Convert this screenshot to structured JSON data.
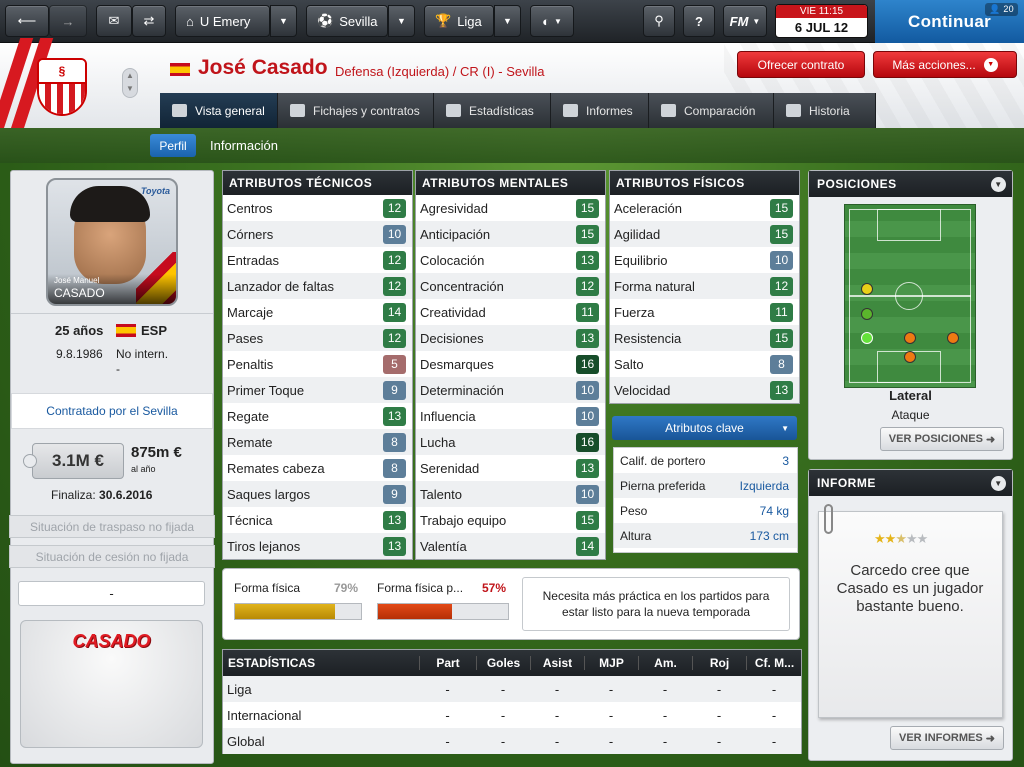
{
  "topbar": {
    "manager": "U Emery",
    "club": "Sevilla",
    "competition": "Liga",
    "fm_label": "FM",
    "date_line1": "VIE 11:15",
    "date_line2": "6 JUL 12",
    "continue_label": "Continuar",
    "continue_badge": "20"
  },
  "player": {
    "name": "José Casado",
    "position": "Defensa (Izquierda) / CR (I) - Sevilla",
    "age": "25 años",
    "nationality": "ESP",
    "dob": "9.8.1986",
    "intl": "No intern.",
    "intl_dash": "-",
    "contract_label": "Contratado por el Sevilla",
    "value": "3.1M €",
    "wage": "875m €",
    "wage_period": "al año",
    "expires_label": "Finaliza:",
    "expires": "30.6.2016",
    "transfer_status": "Situación de traspaso no fijada",
    "loan_status": "Situación de cesión no fijada",
    "dash_box": "-",
    "photo_firstname": "José Manuel",
    "photo_surname": "CASADO",
    "photo_logo": "Toyota",
    "shirt_name": "CASADO"
  },
  "header_buttons": {
    "offer": "Ofrecer contrato",
    "more": "Más acciones..."
  },
  "tabs": [
    "Vista general",
    "Fichajes y contratos",
    "Estadísticas",
    "Informes",
    "Comparación",
    "Historia"
  ],
  "subnav": {
    "profile": "Perfil",
    "info": "Información"
  },
  "technical": {
    "title": "ATRIBUTOS TÉCNICOS",
    "rows": [
      {
        "name": "Centros",
        "value": "12",
        "color": "#2f7c46"
      },
      {
        "name": "Córners",
        "value": "10",
        "color": "#5d7e99"
      },
      {
        "name": "Entradas",
        "value": "12",
        "color": "#2f7c46"
      },
      {
        "name": "Lanzador de faltas",
        "value": "12",
        "color": "#2f7c46"
      },
      {
        "name": "Marcaje",
        "value": "14",
        "color": "#2f7c46"
      },
      {
        "name": "Pases",
        "value": "12",
        "color": "#2f7c46"
      },
      {
        "name": "Penaltis",
        "value": "5",
        "color": "#a56c6c"
      },
      {
        "name": "Primer Toque",
        "value": "9",
        "color": "#5d7e99"
      },
      {
        "name": "Regate",
        "value": "13",
        "color": "#2f7c46"
      },
      {
        "name": "Remate",
        "value": "8",
        "color": "#5d7e99"
      },
      {
        "name": "Remates cabeza",
        "value": "8",
        "color": "#5d7e99"
      },
      {
        "name": "Saques largos",
        "value": "9",
        "color": "#5d7e99"
      },
      {
        "name": "Técnica",
        "value": "13",
        "color": "#2f7c46"
      },
      {
        "name": "Tiros lejanos",
        "value": "13",
        "color": "#2f7c46"
      }
    ]
  },
  "mental": {
    "title": "ATRIBUTOS MENTALES",
    "rows": [
      {
        "name": "Agresividad",
        "value": "15",
        "color": "#2f7c46"
      },
      {
        "name": "Anticipación",
        "value": "15",
        "color": "#2f7c46"
      },
      {
        "name": "Colocación",
        "value": "13",
        "color": "#2f7c46"
      },
      {
        "name": "Concentración",
        "value": "12",
        "color": "#2f7c46"
      },
      {
        "name": "Creatividad",
        "value": "11",
        "color": "#2f7c46"
      },
      {
        "name": "Decisiones",
        "value": "13",
        "color": "#2f7c46"
      },
      {
        "name": "Desmarques",
        "value": "16",
        "color": "#174d2a"
      },
      {
        "name": "Determinación",
        "value": "10",
        "color": "#5d7e99"
      },
      {
        "name": "Influencia",
        "value": "10",
        "color": "#5d7e99"
      },
      {
        "name": "Lucha",
        "value": "16",
        "color": "#174d2a"
      },
      {
        "name": "Serenidad",
        "value": "13",
        "color": "#2f7c46"
      },
      {
        "name": "Talento",
        "value": "10",
        "color": "#5d7e99"
      },
      {
        "name": "Trabajo equipo",
        "value": "15",
        "color": "#2f7c46"
      },
      {
        "name": "Valentía",
        "value": "14",
        "color": "#2f7c46"
      }
    ]
  },
  "physical": {
    "title": "ATRIBUTOS FÍSICOS",
    "rows": [
      {
        "name": "Aceleración",
        "value": "15",
        "color": "#2f7c46"
      },
      {
        "name": "Agilidad",
        "value": "15",
        "color": "#2f7c46"
      },
      {
        "name": "Equilibrio",
        "value": "10",
        "color": "#5d7e99"
      },
      {
        "name": "Forma natural",
        "value": "12",
        "color": "#2f7c46"
      },
      {
        "name": "Fuerza",
        "value": "11",
        "color": "#2f7c46"
      },
      {
        "name": "Resistencia",
        "value": "15",
        "color": "#2f7c46"
      },
      {
        "name": "Salto",
        "value": "8",
        "color": "#5d7e99"
      },
      {
        "name": "Velocidad",
        "value": "13",
        "color": "#2f7c46"
      }
    ]
  },
  "key_attributes": {
    "title": "Atributos clave",
    "rows": [
      {
        "name": "Calif. de portero",
        "value": "3"
      },
      {
        "name": "Pierna preferida",
        "value": "Izquierda"
      },
      {
        "name": "Peso",
        "value": "74 kg"
      },
      {
        "name": "Altura",
        "value": "173 cm"
      }
    ]
  },
  "fitness": {
    "physical_label": "Forma física",
    "physical_pct": "79%",
    "physical_level": 0.79,
    "match_label": "Forma física p...",
    "match_pct": "57%",
    "match_level": 0.57,
    "note": "Necesita más práctica en los partidos para estar listo para la nueva temporada"
  },
  "stats": {
    "title": "ESTADÍSTICAS",
    "columns": [
      "Part",
      "Goles",
      "Asist",
      "MJP",
      "Am.",
      "Roj",
      "Cf. M..."
    ],
    "rows": [
      {
        "label": "Liga",
        "values": [
          "-",
          "-",
          "-",
          "-",
          "-",
          "-",
          "-"
        ]
      },
      {
        "label": "Internacional",
        "values": [
          "-",
          "-",
          "-",
          "-",
          "-",
          "-",
          "-"
        ]
      },
      {
        "label": "Global",
        "values": [
          "-",
          "-",
          "-",
          "-",
          "-",
          "-",
          "-"
        ]
      }
    ]
  },
  "positions": {
    "title": "POSICIONES",
    "role": "Lateral",
    "duty": "Ataque",
    "button": "VER POSICIONES"
  },
  "report": {
    "title": "INFORME",
    "stars": 2.5,
    "text": "Carcedo cree que Casado es un jugador bastante bueno.",
    "button": "VER INFORMES"
  }
}
